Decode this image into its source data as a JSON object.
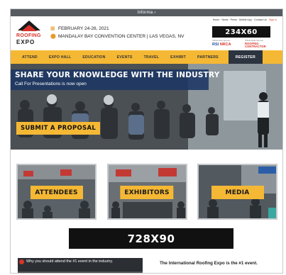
{
  "topbar": {
    "label": "Informa ›"
  },
  "header": {
    "logo_line1": "ROOFING",
    "logo_line2": "EXPO",
    "event_date": "FEBRUARY 24-26, 2021",
    "event_venue": "MANDALAY BAY CONVENTION CENTER | LAS VEGAS, NV",
    "util_links": "Home · News · Press · Mobile App · Contact Us ·",
    "sign_in": "Sign in",
    "ad_small": "234X60",
    "sponsor_caption_1": "Official Show Sponsor",
    "sponsor_caption_2": "Official Media Sponsor",
    "sponsor_1a": "RSI",
    "sponsor_1b": "NRCA",
    "sponsor_2": "ROOFING CONTRACTOR"
  },
  "nav": {
    "items": [
      "ATTEND",
      "EXPO HALL",
      "EDUCATION",
      "EVENTS",
      "TRAVEL",
      "EXHIBIT",
      "PARTNERS"
    ],
    "register": "REGISTER"
  },
  "hero": {
    "headline": "SHARE YOUR KNOWLEDGE WITH THE INDUSTRY",
    "subheadline": "Call For Presentations is now open",
    "cta": "SUBMIT A PROPOSAL"
  },
  "tiles": [
    {
      "label": "ATTENDEES"
    },
    {
      "label": "EXHIBITORS"
    },
    {
      "label": "MEDIA"
    }
  ],
  "ad_banner": "728X90",
  "video": {
    "title": "Why you should attend the #1 event in the industry."
  },
  "intro_text": "The International Roofing Expo is the #1 event.",
  "colors": {
    "accent": "#f5b834",
    "nav_dark": "#2c3440",
    "hero_banner": "#1c3764",
    "brand_red": "#d9342b"
  },
  "icons": {
    "calendar": "calendar-icon",
    "location": "location-pin-icon",
    "play": "play-icon"
  }
}
